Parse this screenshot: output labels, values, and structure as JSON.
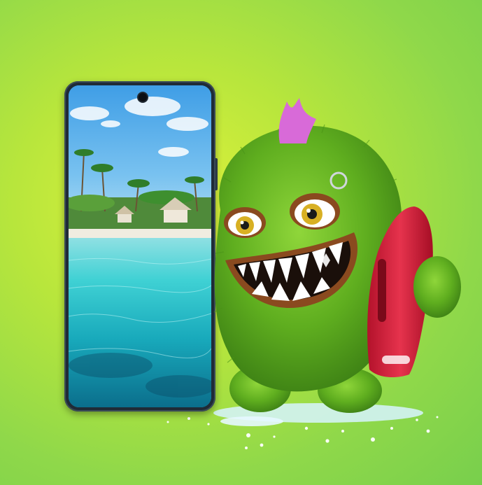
{
  "scene": {
    "description_colors": {
      "background_light": "#dff23a",
      "background_dark": "#78cf4c",
      "phone_frame": "#1f2b36",
      "monster_fur": "#5fae1f",
      "monster_mohawk": "#d86ad8",
      "surfboard": "#e0233f",
      "water": "#2fd2d8"
    }
  },
  "icons": {
    "phone": "smartphone-icon",
    "monster": "monster-mascot-icon"
  }
}
